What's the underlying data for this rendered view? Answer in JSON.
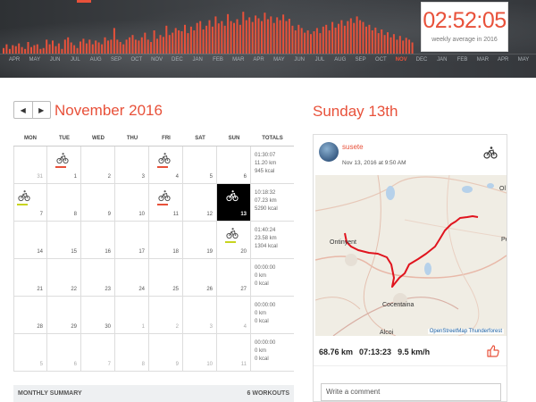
{
  "banner": {
    "months": [
      "APR",
      "MAY",
      "JUN",
      "JUL",
      "AUG",
      "SEP",
      "OCT",
      "NOV",
      "DEC",
      "JAN",
      "FEB",
      "MAR",
      "APR",
      "MAY",
      "JUN",
      "JUL",
      "AUG",
      "SEP",
      "OCT",
      "NOV",
      "DEC",
      "JAN",
      "FEB",
      "MAR",
      "APR",
      "MAY"
    ],
    "active_month_index": 19,
    "bar_color": "#e8513a",
    "bar_levels": [
      0.12,
      0.2,
      0.1,
      0.18,
      0.16,
      0.22,
      0.14,
      0.1,
      0.25,
      0.14,
      0.18,
      0.2,
      0.1,
      0.12,
      0.3,
      0.2,
      0.28,
      0.16,
      0.22,
      0.1,
      0.3,
      0.35,
      0.24,
      0.18,
      0.12,
      0.26,
      0.32,
      0.22,
      0.3,
      0.2,
      0.28,
      0.24,
      0.2,
      0.35,
      0.28,
      0.3,
      0.55,
      0.3,
      0.25,
      0.2,
      0.3,
      0.35,
      0.4,
      0.3,
      0.28,
      0.35,
      0.45,
      0.3,
      0.25,
      0.5,
      0.32,
      0.4,
      0.36,
      0.6,
      0.4,
      0.45,
      0.55,
      0.5,
      0.48,
      0.62,
      0.44,
      0.58,
      0.5,
      0.66,
      0.7,
      0.52,
      0.6,
      0.72,
      0.58,
      0.8,
      0.65,
      0.7,
      0.6,
      0.85,
      0.7,
      0.66,
      0.74,
      0.62,
      0.9,
      0.72,
      0.78,
      0.68,
      0.82,
      0.76,
      0.7,
      0.88,
      0.74,
      0.8,
      0.66,
      0.78,
      0.72,
      0.84,
      0.7,
      0.75,
      0.6,
      0.5,
      0.62,
      0.55,
      0.45,
      0.5,
      0.42,
      0.48,
      0.55,
      0.44,
      0.58,
      0.62,
      0.5,
      0.68,
      0.56,
      0.64,
      0.72,
      0.6,
      0.7,
      0.76,
      0.66,
      0.8,
      0.72,
      0.68,
      0.58,
      0.62,
      0.5,
      0.56,
      0.44,
      0.52,
      0.4,
      0.46,
      0.35,
      0.42,
      0.3,
      0.38,
      0.28,
      0.34,
      0.3,
      0.24
    ],
    "weekly_avg_time": "02:52:05",
    "weekly_avg_label": "weekly average in 2016"
  },
  "calendar": {
    "prev_icon": "◀",
    "next_icon": "▶",
    "title": "November 2016",
    "weekdays": [
      "MON",
      "TUE",
      "WED",
      "THU",
      "FRI",
      "SAT",
      "SUN"
    ],
    "totals_header": "TOTALS",
    "accent": "#e8513a",
    "weeks": [
      {
        "days": [
          {
            "n": "31",
            "muted": true
          },
          {
            "n": "1",
            "bike": "red"
          },
          {
            "n": "2"
          },
          {
            "n": "3"
          },
          {
            "n": "4",
            "bike": "red"
          },
          {
            "n": "5"
          },
          {
            "n": "6"
          }
        ],
        "totals": [
          "01:30:07",
          "11.20 km",
          "945 kcal"
        ]
      },
      {
        "days": [
          {
            "n": "7",
            "bike": "yellow"
          },
          {
            "n": "8"
          },
          {
            "n": "9"
          },
          {
            "n": "10"
          },
          {
            "n": "11",
            "bike": "red"
          },
          {
            "n": "12"
          },
          {
            "n": "13",
            "selected": true,
            "bike": "white"
          }
        ],
        "totals": [
          "10:18:32",
          "07.23 km",
          "5290 kcal"
        ]
      },
      {
        "days": [
          {
            "n": "14"
          },
          {
            "n": "15"
          },
          {
            "n": "16"
          },
          {
            "n": "17"
          },
          {
            "n": "18"
          },
          {
            "n": "19"
          },
          {
            "n": "20",
            "bike": "yellow"
          }
        ],
        "totals": [
          "01:40:24",
          "23.58 km",
          "1304 kcal"
        ]
      },
      {
        "days": [
          {
            "n": "21"
          },
          {
            "n": "22"
          },
          {
            "n": "23"
          },
          {
            "n": "24"
          },
          {
            "n": "25"
          },
          {
            "n": "26"
          },
          {
            "n": "27"
          }
        ],
        "totals": [
          "00:00:00",
          "0 km",
          "0 kcal"
        ]
      },
      {
        "days": [
          {
            "n": "28"
          },
          {
            "n": "29"
          },
          {
            "n": "30"
          },
          {
            "n": "1",
            "muted": true
          },
          {
            "n": "2",
            "muted": true
          },
          {
            "n": "3",
            "muted": true
          },
          {
            "n": "4",
            "muted": true
          }
        ],
        "totals": [
          "00:00:00",
          "0 km",
          "0 kcal"
        ]
      },
      {
        "days": [
          {
            "n": "5",
            "muted": true
          },
          {
            "n": "6",
            "muted": true
          },
          {
            "n": "7",
            "muted": true
          },
          {
            "n": "8",
            "muted": true
          },
          {
            "n": "9",
            "muted": true
          },
          {
            "n": "10",
            "muted": true
          },
          {
            "n": "11",
            "muted": true
          }
        ],
        "totals": [
          "00:00:00",
          "0 km",
          "0 kcal"
        ]
      }
    ],
    "summary_label": "MONTHLY SUMMARY",
    "summary_count": "6 WORKOUTS"
  },
  "day_panel": {
    "title": "Sunday 13th",
    "user": "susete",
    "date": "Nov 13, 2016 at 9:50 AM",
    "map_labels": {
      "town1": "Ontinyent",
      "town2": "Cocentaina",
      "town3": "Alcoi",
      "edge_ol": "Ol",
      "edge_pe": "Pe"
    },
    "attribution_osm": "OpenStreetMap",
    "attribution_tf": "Thunderforest",
    "distance": "68.76 km",
    "duration": "07:13:23",
    "speed": "9.5 km/h",
    "comment_placeholder": "Write a comment",
    "route_color": "#e0141e"
  }
}
